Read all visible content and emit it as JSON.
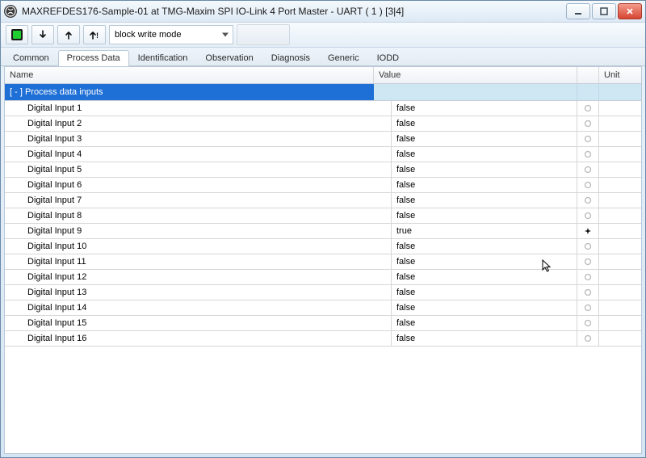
{
  "window": {
    "title": "MAXREFDES176-Sample-01 at TMG-Maxim SPI IO-Link 4 Port Master - UART ( 1 ) [3|4]"
  },
  "toolbar": {
    "mode_selected": "block write mode"
  },
  "tabs": [
    {
      "label": "Common",
      "active": false
    },
    {
      "label": "Process Data",
      "active": true
    },
    {
      "label": "Identification",
      "active": false
    },
    {
      "label": "Observation",
      "active": false
    },
    {
      "label": "Diagnosis",
      "active": false
    },
    {
      "label": "Generic",
      "active": false
    },
    {
      "label": "IODD",
      "active": false
    }
  ],
  "columns": {
    "name": "Name",
    "value": "Value",
    "unit": "Unit"
  },
  "section": {
    "label": "[ - ] Process data inputs"
  },
  "rows": [
    {
      "name": "Digital Input 1",
      "value": "false",
      "on": false
    },
    {
      "name": "Digital Input 2",
      "value": "false",
      "on": false
    },
    {
      "name": "Digital Input 3",
      "value": "false",
      "on": false
    },
    {
      "name": "Digital Input 4",
      "value": "false",
      "on": false
    },
    {
      "name": "Digital Input 5",
      "value": "false",
      "on": false
    },
    {
      "name": "Digital Input 6",
      "value": "false",
      "on": false
    },
    {
      "name": "Digital Input 7",
      "value": "false",
      "on": false
    },
    {
      "name": "Digital Input 8",
      "value": "false",
      "on": false
    },
    {
      "name": "Digital Input 9",
      "value": "true",
      "on": true
    },
    {
      "name": "Digital Input 10",
      "value": "false",
      "on": false
    },
    {
      "name": "Digital Input 11",
      "value": "false",
      "on": false
    },
    {
      "name": "Digital Input 12",
      "value": "false",
      "on": false
    },
    {
      "name": "Digital Input 13",
      "value": "false",
      "on": false
    },
    {
      "name": "Digital Input 14",
      "value": "false",
      "on": false
    },
    {
      "name": "Digital Input 15",
      "value": "false",
      "on": false
    },
    {
      "name": "Digital Input 16",
      "value": "false",
      "on": false
    }
  ]
}
